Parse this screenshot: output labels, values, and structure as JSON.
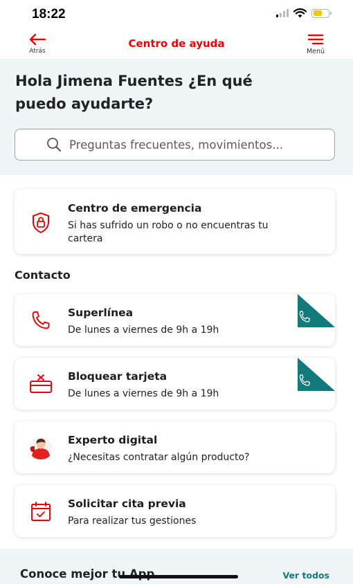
{
  "status_bar": {
    "time": "18:22"
  },
  "nav": {
    "back_label": "Atrás",
    "title": "Centro de ayuda",
    "menu_label": "Menú"
  },
  "hero": {
    "greeting": "Hola Jimena Fuentes ¿En qué puedo ayudarte?",
    "search_placeholder": "Preguntas frecuentes, movimientos..."
  },
  "emergency": {
    "title": "Centro de emergencia",
    "subtitle": "Si has sufrido un robo o no encuentras tu cartera",
    "icon": "shield-lock-icon"
  },
  "contact": {
    "section_title": "Contacto",
    "items": [
      {
        "title": "Superlínea",
        "subtitle": "De lunes a viernes de 9h a 19h",
        "icon": "phone-icon",
        "has_call_tag": true
      },
      {
        "title": "Bloquear tarjeta",
        "subtitle": "De lunes a viernes de 9h a 19h",
        "icon": "block-card-icon",
        "has_call_tag": true
      },
      {
        "title": "Experto digital",
        "subtitle": "¿Necesitas contratar algún producto?",
        "icon": "expert-avatar-icon",
        "has_call_tag": false
      },
      {
        "title": "Solicitar cita previa",
        "subtitle": "Para realizar tus gestiones",
        "icon": "calendar-check-icon",
        "has_call_tag": false
      }
    ]
  },
  "app_section": {
    "title": "Conoce mejor tu App",
    "see_all": "Ver todos"
  },
  "colors": {
    "brand_red": "#ec0000",
    "accent_teal": "#127a7a",
    "hero_bg": "#f0f5f8"
  }
}
